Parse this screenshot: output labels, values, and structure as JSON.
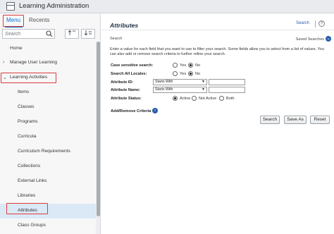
{
  "window": {
    "title": "Learning Administration"
  },
  "tabs": {
    "menu": "Menu",
    "recents": "Recents"
  },
  "search": {
    "placeholder": "Search"
  },
  "nav": {
    "items": [
      {
        "label": "Home",
        "level": "top",
        "expanded": false
      },
      {
        "label": "Manage User Learning",
        "level": "top",
        "expanded": false
      },
      {
        "label": "Learning Activities",
        "level": "top",
        "expanded": true
      },
      {
        "label": "Items",
        "level": "sub"
      },
      {
        "label": "Classes",
        "level": "sub"
      },
      {
        "label": "Programs",
        "level": "sub"
      },
      {
        "label": "Curricula",
        "level": "sub"
      },
      {
        "label": "Curriculum Requirements",
        "level": "sub"
      },
      {
        "label": "Collections",
        "level": "sub"
      },
      {
        "label": "External Links",
        "level": "sub"
      },
      {
        "label": "Libraries",
        "level": "sub"
      },
      {
        "label": "Attributes",
        "level": "sub",
        "active": true
      },
      {
        "label": "Class Groups",
        "level": "sub"
      }
    ]
  },
  "main": {
    "title": "Attributes",
    "help_link": "Search",
    "section_label": "Search",
    "saved_searches": "Saved Searches",
    "description": "Enter a value for each field that you want to use to filter your search. Some fields allow you to select from a list of values. You can also add or remove search criteria to further refine your search.",
    "fields": {
      "case_sensitive": {
        "label": "Case sensitive search:",
        "options": [
          "Yes",
          "No"
        ],
        "selected": "No"
      },
      "all_locales": {
        "label": "Search All Locales:",
        "options": [
          "Yes",
          "No"
        ],
        "selected": "No"
      },
      "attribute_id": {
        "label": "Attribute ID:",
        "operator": "Starts With",
        "value": ""
      },
      "attribute_name": {
        "label": "Attribute Name:",
        "operator": "Starts With",
        "value": ""
      },
      "attribute_status": {
        "label": "Attribute Status:",
        "options": [
          "Active",
          "Not Active",
          "Both"
        ],
        "selected": "Active"
      }
    },
    "add_remove": "Add/Remove Criteria",
    "buttons": {
      "search": "Search",
      "save_as": "Save As",
      "reset": "Reset"
    }
  },
  "colors": {
    "highlight": "#d93b3b",
    "accent": "#0a6ed1",
    "active_row": "#dbe9f7"
  }
}
